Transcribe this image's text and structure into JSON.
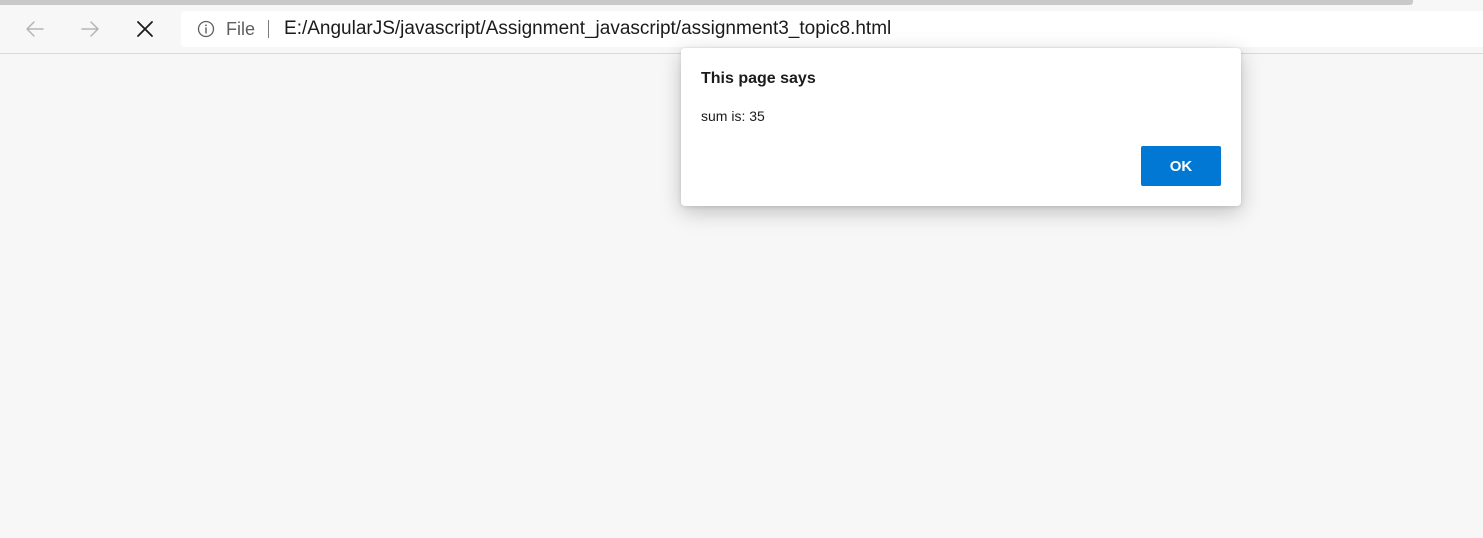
{
  "browser": {
    "address_bar": {
      "scheme_label": "File",
      "url": "E:/AngularJS/javascript/Assignment_javascript/assignment3_topic8.html"
    },
    "icons": {
      "back": "arrow-left-icon",
      "forward": "arrow-right-icon",
      "stop": "close-icon",
      "info": "info-icon"
    }
  },
  "dialog": {
    "title": "This page says",
    "message": "sum is: 35",
    "ok_label": "OK"
  },
  "colors": {
    "accent": "#0078d4",
    "background": "#f7f7f7"
  }
}
